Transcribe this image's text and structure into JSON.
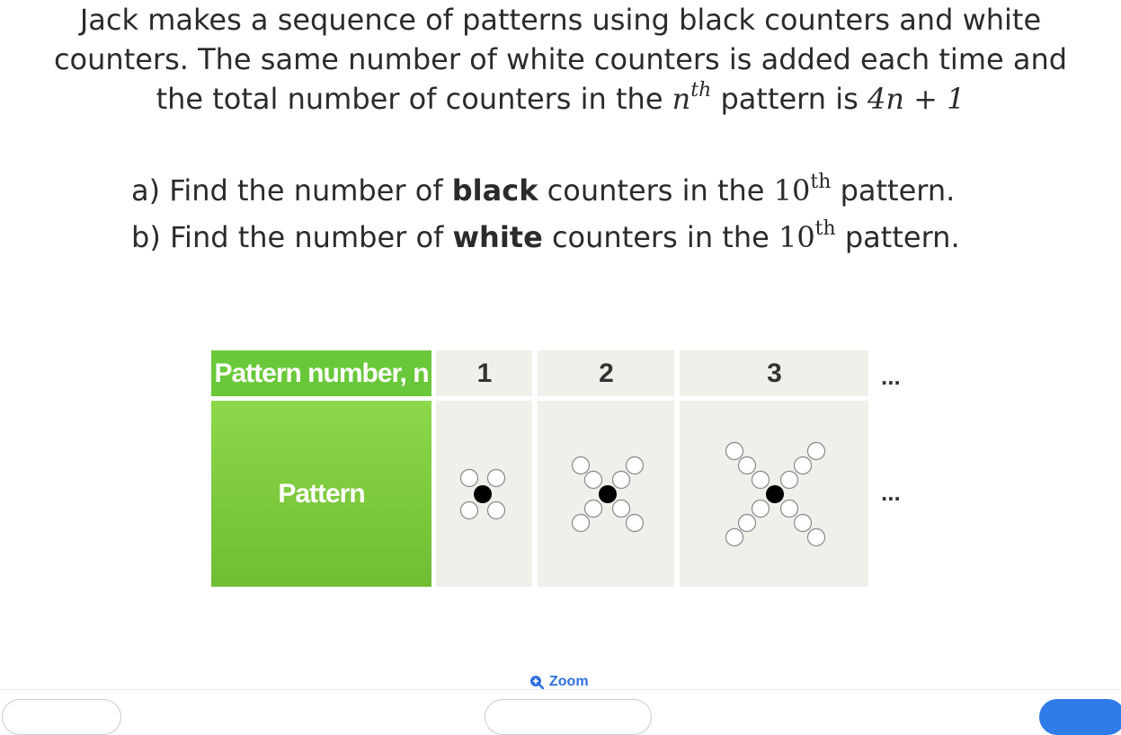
{
  "question": {
    "line1": "Jack makes a sequence of patterns using black counters and white",
    "line2": "counters. The same number of white counters is added each time and",
    "line3_prefix": "the total number of counters in the ",
    "line3_var": "n",
    "line3_sup": "th",
    "line3_mid": " pattern is ",
    "line3_expr": "4n + 1"
  },
  "parts": [
    {
      "prefix": "a) Find the number of ",
      "bold": "black",
      "mid": " counters in the ",
      "num": "10",
      "sup": "th",
      "suffix": " pattern."
    },
    {
      "prefix": "b) Find the number of ",
      "bold": "white",
      "mid": " counters in the ",
      "num": "10",
      "sup": "th",
      "suffix": " pattern."
    }
  ],
  "table": {
    "row1_header": "Pattern number, n",
    "row2_header": "Pattern",
    "columns": [
      "1",
      "2",
      "3"
    ],
    "ellipsis": "..."
  },
  "patterns": [
    {
      "n": 1,
      "black_counters": 1,
      "white_counters": 4
    },
    {
      "n": 2,
      "black_counters": 1,
      "white_counters": 8
    },
    {
      "n": 3,
      "black_counters": 1,
      "white_counters": 12
    }
  ],
  "colors": {
    "header_green": "#69c83a",
    "cell_grey": "#f0efea",
    "link_blue": "#2f6fe0"
  },
  "zoom": {
    "label": "Zoom",
    "icon": "zoom-in-icon"
  }
}
